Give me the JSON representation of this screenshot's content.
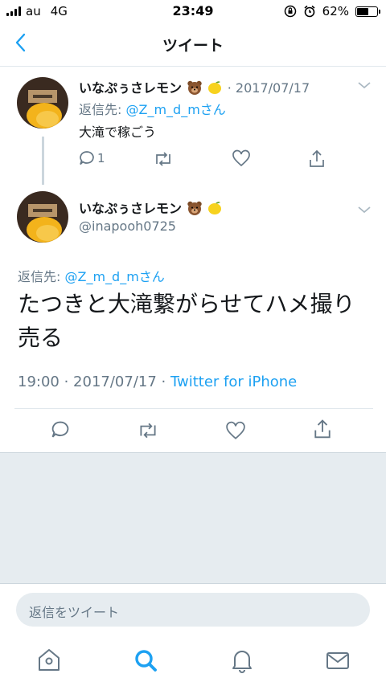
{
  "status": {
    "carrier": "au",
    "network": "4G",
    "time": "23:49",
    "battery": "62%",
    "battery_level": 0.62
  },
  "nav": {
    "title": "ツイート"
  },
  "parent": {
    "name": "いなぷぅさレモン",
    "date": "· 2017/07/17",
    "reply_label": "返信先:",
    "reply_to": "@Z_m_d_mさん",
    "text": "大滝で稼ごう",
    "reply_count": "1"
  },
  "main": {
    "name": "いなぷぅさレモン",
    "handle": "@inapooh0725",
    "reply_label": "返信先:",
    "reply_to": "@Z_m_d_mさん",
    "text": "たつきと大滝繋がらせてハメ撮り売る",
    "time": "19:00 · 2017/07/17 ·",
    "client": "Twitter for iPhone"
  },
  "compose": {
    "placeholder": "返信をツイート"
  },
  "colors": {
    "accent": "#1da1f2",
    "text": "#14171a",
    "muted": "#657786"
  }
}
